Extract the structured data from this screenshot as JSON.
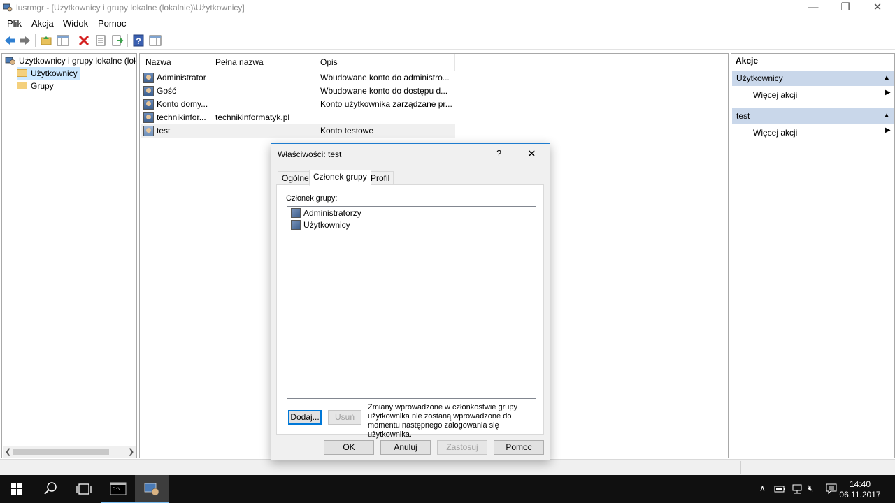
{
  "window": {
    "title": "lusrmgr - [Użytkownicy i grupy lokalne (lokalnie)\\Użytkownicy]",
    "minimize": "—",
    "restore": "❐",
    "close": "✕"
  },
  "menu": [
    "Plik",
    "Akcja",
    "Widok",
    "Pomoc"
  ],
  "tree": {
    "root": "Użytkownicy i grupy lokalne (lok",
    "items": [
      "Użytkownicy",
      "Grupy"
    ],
    "selected": "Użytkownicy"
  },
  "list": {
    "columns": [
      "Nazwa",
      "Pełna nazwa",
      "Opis"
    ],
    "rows": [
      {
        "name": "Administrator",
        "full_name": "",
        "desc": "Wbudowane konto do administro..."
      },
      {
        "name": "Gość",
        "full_name": "",
        "desc": "Wbudowane konto do dostępu d..."
      },
      {
        "name": "Konto domy...",
        "full_name": "",
        "desc": "Konto użytkownika zarządzane pr..."
      },
      {
        "name": "technikinfor...",
        "full_name": "technikinformatyk.pl",
        "desc": ""
      },
      {
        "name": "test",
        "full_name": "",
        "desc": "Konto testowe"
      }
    ]
  },
  "actions": {
    "title": "Akcje",
    "sections": [
      {
        "header": "Użytkownicy",
        "item": "Więcej akcji"
      },
      {
        "header": "test",
        "item": "Więcej akcji"
      }
    ]
  },
  "dialog": {
    "title": "Właściwości: test",
    "help": "?",
    "close": "✕",
    "tabs": [
      "Ogólne",
      "Członek grupy",
      "Profil"
    ],
    "active_tab": "Członek grupy",
    "members_label": "Członek grupy:",
    "members": [
      "Administratorzy",
      "Użytkownicy"
    ],
    "add": "Dodaj...",
    "remove": "Usuń",
    "note": "Zmiany wprowadzone w członkostwie grupy użytkownika nie zostaną wprowadzone do momentu następnego zalogowania się użytkownika.",
    "ok": "OK",
    "cancel": "Anuluj",
    "apply": "Zastosuj",
    "help_btn": "Pomoc"
  },
  "taskbar": {
    "time": "14:40",
    "date": "06.11.2017"
  },
  "colors": {
    "selection": "#cce8ff",
    "action_header": "#c9d7ea",
    "dialog_border": "#1d7ccf",
    "taskbar": "#101010"
  }
}
